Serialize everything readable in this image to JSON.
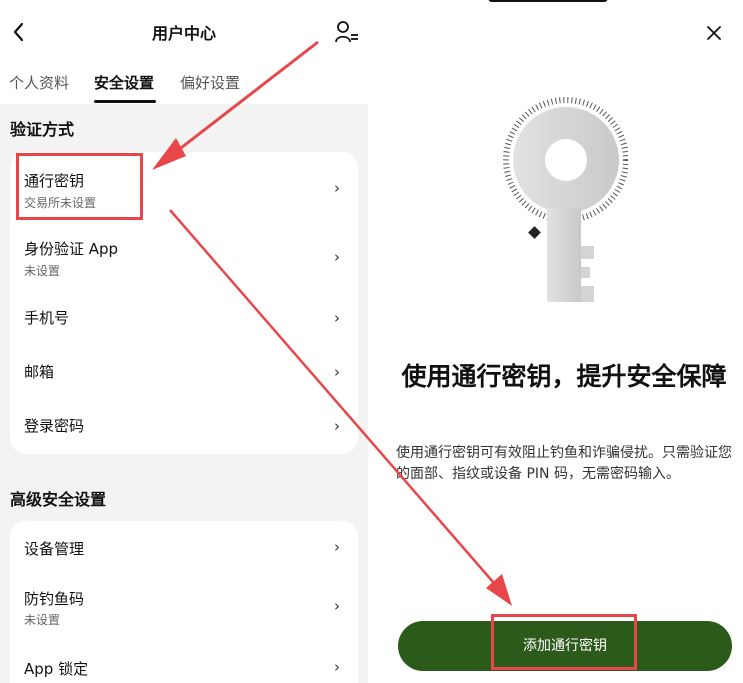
{
  "left": {
    "header": {
      "title": "用户中心",
      "back_icon": "back-chevron-icon",
      "user_icon": "user-settings-icon"
    },
    "tabs": [
      {
        "label": "个人资料"
      },
      {
        "label": "安全设置"
      },
      {
        "label": "偏好设置"
      }
    ],
    "active_tab": "安全设置",
    "sections": [
      {
        "title": "验证方式",
        "rows": [
          {
            "label": "通行密钥",
            "sub": "交易所未设置"
          },
          {
            "label": "身份验证 App",
            "sub": "未设置"
          },
          {
            "label": "手机号",
            "sub": ""
          },
          {
            "label": "邮箱",
            "sub": ""
          },
          {
            "label": "登录密码",
            "sub": ""
          }
        ]
      },
      {
        "title": "高级安全设置",
        "rows": [
          {
            "label": "设备管理",
            "sub": ""
          },
          {
            "label": "防钓鱼码",
            "sub": "未设置"
          },
          {
            "label": "App 锁定",
            "sub": ""
          }
        ]
      }
    ]
  },
  "right": {
    "close_icon": "close-icon",
    "illustration": "key-icon",
    "headline": "使用通行密钥，提升安全保障",
    "description": "使用通行密钥可有效阻止钓鱼和诈骗侵扰。只需验证您的面部、指纹或设备 PIN 码，无需密码输入。",
    "cta_label": "添加通行密钥"
  },
  "colors": {
    "accent": "#2b5a1b",
    "annotation": "#e8474a",
    "panel_bg": "#f3f3f3"
  }
}
